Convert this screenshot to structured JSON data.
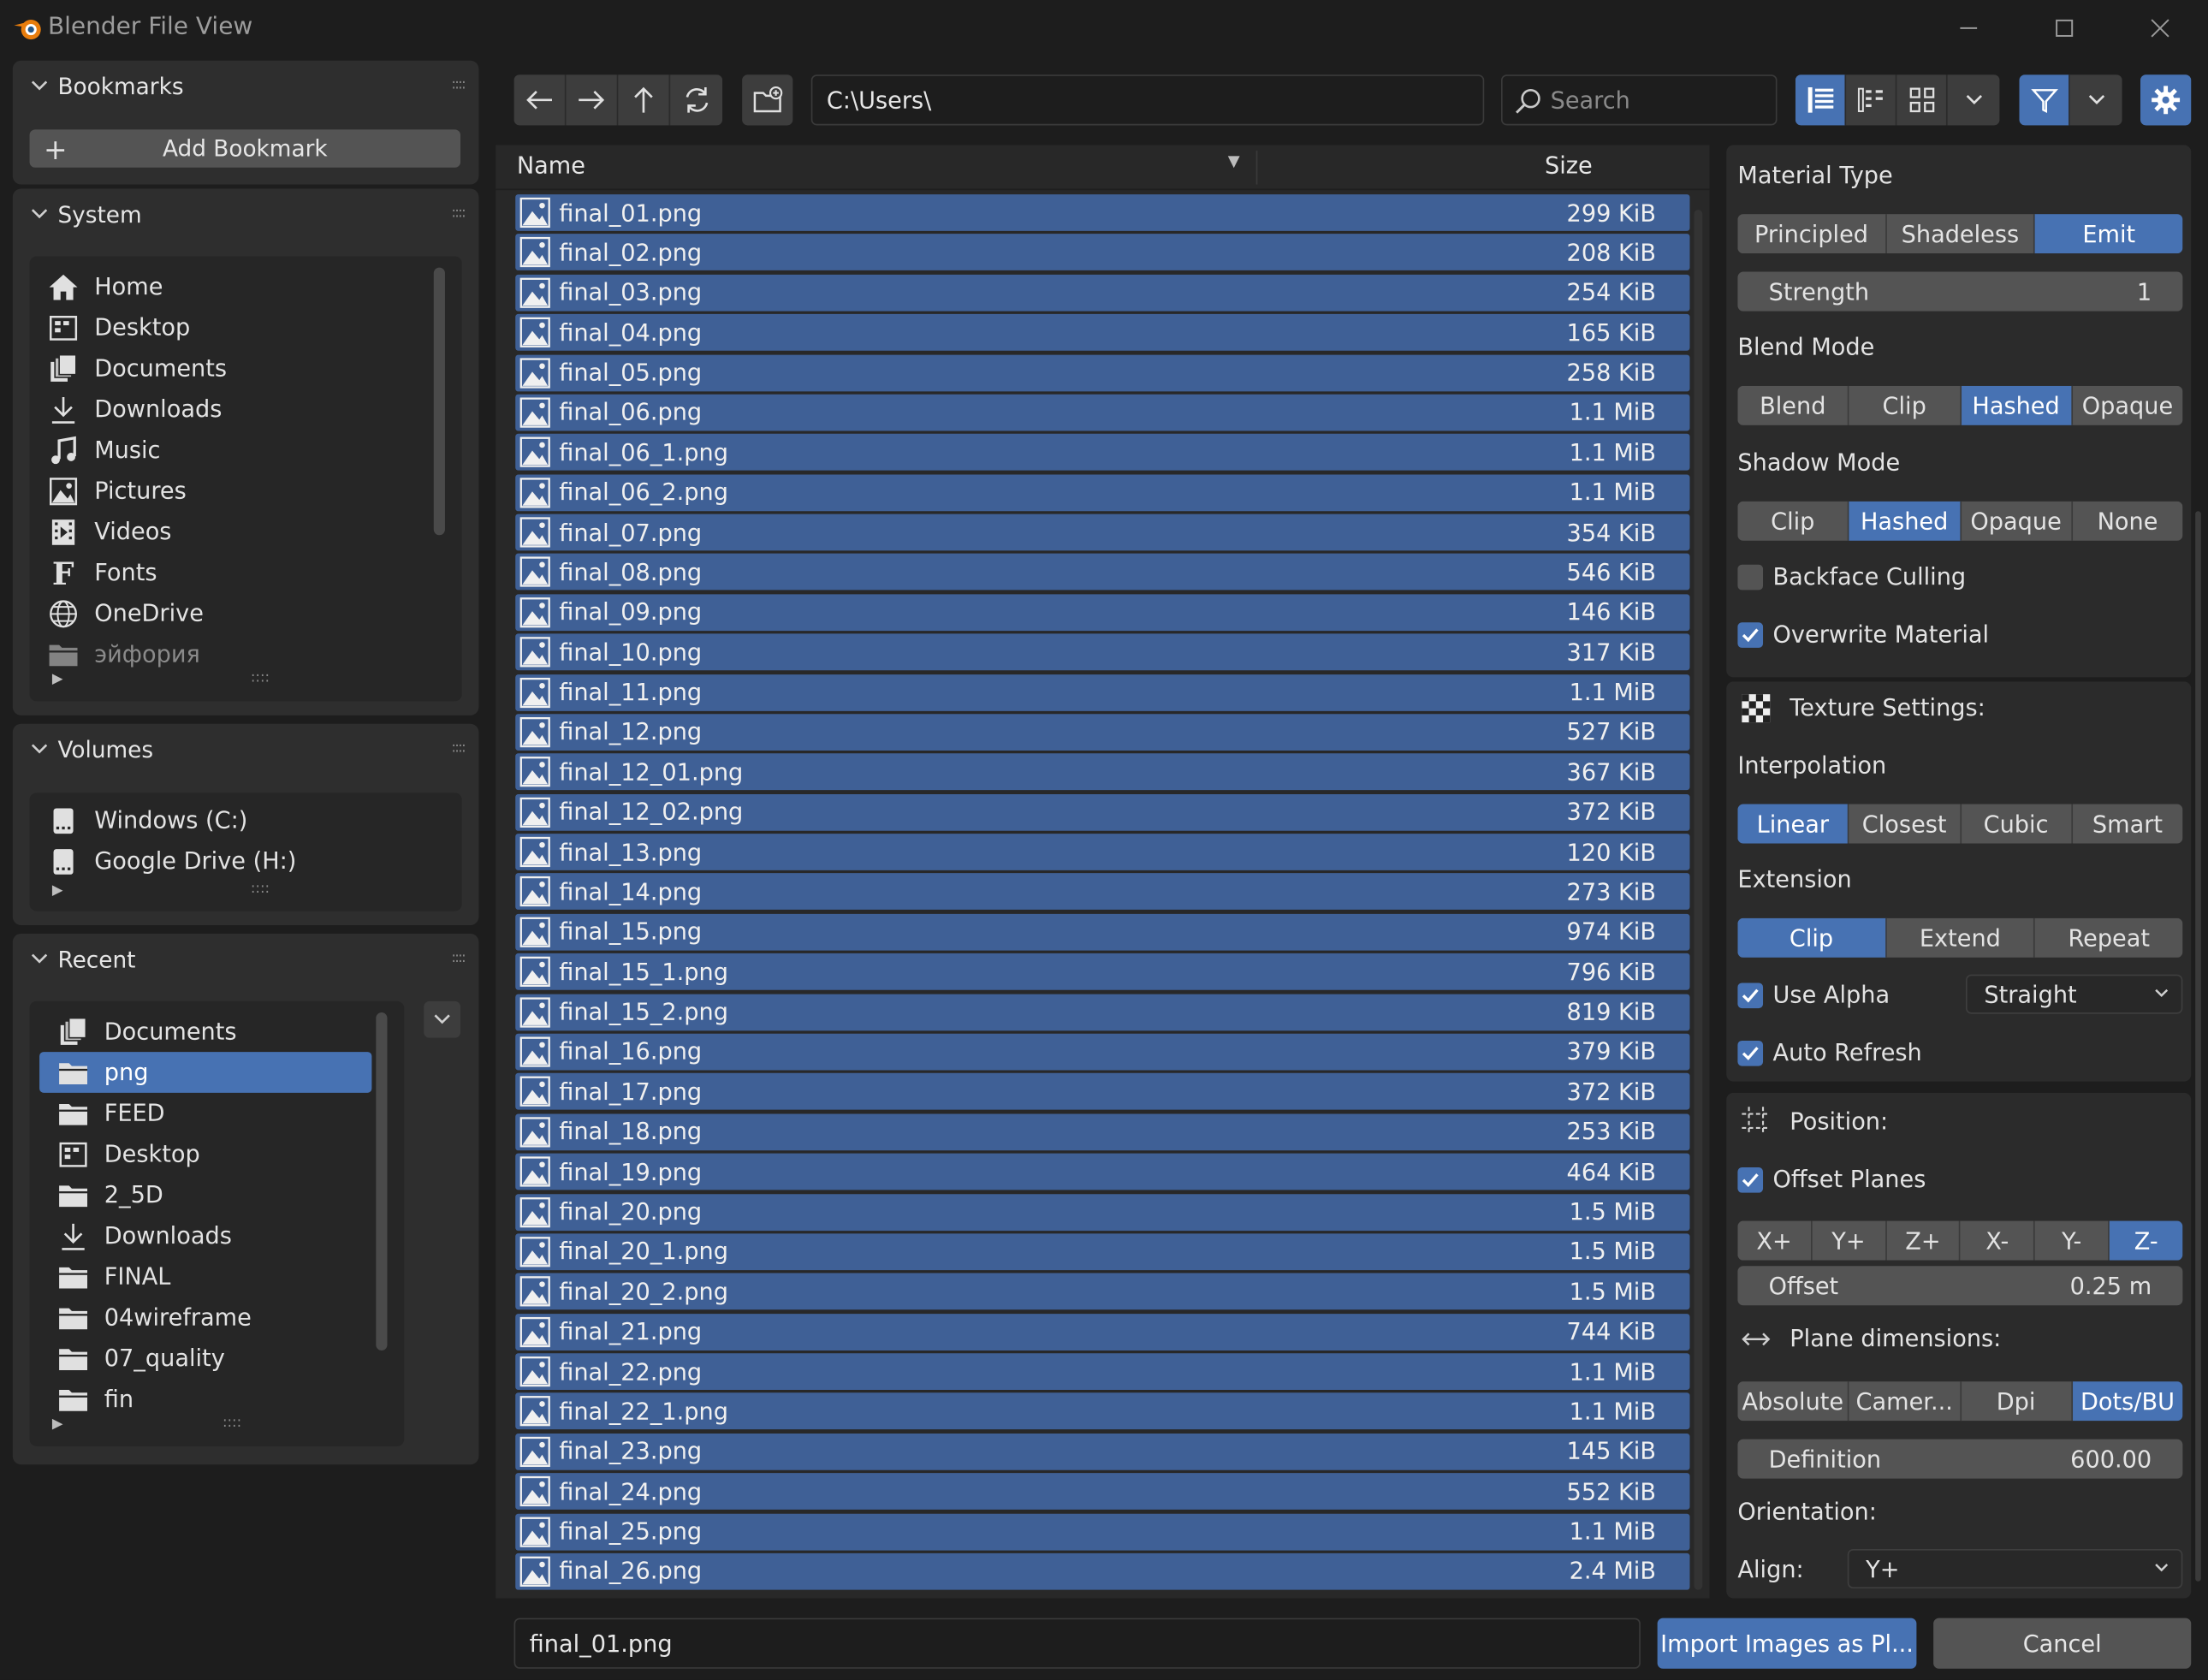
{
  "window": {
    "title": "Blender File View",
    "controls": [
      "minimize-icon",
      "maximize-icon",
      "close-icon"
    ]
  },
  "sidebar": {
    "bookmarks": {
      "title": "Bookmarks",
      "add_label": "Add Bookmark"
    },
    "system": {
      "title": "System",
      "items": [
        {
          "label": "Home",
          "icon": "home-icon"
        },
        {
          "label": "Desktop",
          "icon": "desktop-icon"
        },
        {
          "label": "Documents",
          "icon": "documents-icon"
        },
        {
          "label": "Downloads",
          "icon": "downloads-icon"
        },
        {
          "label": "Music",
          "icon": "music-icon"
        },
        {
          "label": "Pictures",
          "icon": "pictures-icon"
        },
        {
          "label": "Videos",
          "icon": "videos-icon"
        },
        {
          "label": "Fonts",
          "icon": "fonts-icon"
        },
        {
          "label": "OneDrive",
          "icon": "globe-icon"
        },
        {
          "label": "эйфория",
          "icon": "folder-icon"
        }
      ]
    },
    "volumes": {
      "title": "Volumes",
      "items": [
        {
          "label": "Windows (C:)",
          "icon": "drive-icon"
        },
        {
          "label": "Google Drive (H:)",
          "icon": "drive-icon"
        }
      ]
    },
    "recent": {
      "title": "Recent",
      "items": [
        {
          "label": "Documents",
          "icon": "documents-icon",
          "selected": false
        },
        {
          "label": "png",
          "icon": "folder-icon",
          "selected": true
        },
        {
          "label": "FEED",
          "icon": "folder-icon",
          "selected": false
        },
        {
          "label": "Desktop",
          "icon": "desktop-icon",
          "selected": false
        },
        {
          "label": "2_5D",
          "icon": "folder-icon",
          "selected": false
        },
        {
          "label": "Downloads",
          "icon": "downloads-icon",
          "selected": false
        },
        {
          "label": "FINAL",
          "icon": "folder-icon",
          "selected": false
        },
        {
          "label": "04wireframe",
          "icon": "folder-icon",
          "selected": false
        },
        {
          "label": "07_quality",
          "icon": "folder-icon",
          "selected": false
        },
        {
          "label": "fin",
          "icon": "folder-icon",
          "selected": false
        }
      ]
    }
  },
  "toolbar": {
    "path": "C:\\Users\\",
    "search_placeholder": "Search"
  },
  "filelist": {
    "col_name": "Name",
    "col_size": "Size",
    "files": [
      {
        "name": "final_01.png",
        "size": "299 KiB"
      },
      {
        "name": "final_02.png",
        "size": "208 KiB"
      },
      {
        "name": "final_03.png",
        "size": "254 KiB"
      },
      {
        "name": "final_04.png",
        "size": "165 KiB"
      },
      {
        "name": "final_05.png",
        "size": "258 KiB"
      },
      {
        "name": "final_06.png",
        "size": "1.1 MiB"
      },
      {
        "name": "final_06_1.png",
        "size": "1.1 MiB"
      },
      {
        "name": "final_06_2.png",
        "size": "1.1 MiB"
      },
      {
        "name": "final_07.png",
        "size": "354 KiB"
      },
      {
        "name": "final_08.png",
        "size": "546 KiB"
      },
      {
        "name": "final_09.png",
        "size": "146 KiB"
      },
      {
        "name": "final_10.png",
        "size": "317 KiB"
      },
      {
        "name": "final_11.png",
        "size": "1.1 MiB"
      },
      {
        "name": "final_12.png",
        "size": "527 KiB"
      },
      {
        "name": "final_12_01.png",
        "size": "367 KiB"
      },
      {
        "name": "final_12_02.png",
        "size": "372 KiB"
      },
      {
        "name": "final_13.png",
        "size": "120 KiB"
      },
      {
        "name": "final_14.png",
        "size": "273 KiB"
      },
      {
        "name": "final_15.png",
        "size": "974 KiB"
      },
      {
        "name": "final_15_1.png",
        "size": "796 KiB"
      },
      {
        "name": "final_15_2.png",
        "size": "819 KiB"
      },
      {
        "name": "final_16.png",
        "size": "379 KiB"
      },
      {
        "name": "final_17.png",
        "size": "372 KiB"
      },
      {
        "name": "final_18.png",
        "size": "253 KiB"
      },
      {
        "name": "final_19.png",
        "size": "464 KiB"
      },
      {
        "name": "final_20.png",
        "size": "1.5 MiB"
      },
      {
        "name": "final_20_1.png",
        "size": "1.5 MiB"
      },
      {
        "name": "final_20_2.png",
        "size": "1.5 MiB"
      },
      {
        "name": "final_21.png",
        "size": "744 KiB"
      },
      {
        "name": "final_22.png",
        "size": "1.1 MiB"
      },
      {
        "name": "final_22_1.png",
        "size": "1.1 MiB"
      },
      {
        "name": "final_23.png",
        "size": "145 KiB"
      },
      {
        "name": "final_24.png",
        "size": "552 KiB"
      },
      {
        "name": "final_25.png",
        "size": "1.1 MiB"
      },
      {
        "name": "final_26.png",
        "size": "2.4 MiB"
      }
    ]
  },
  "props": {
    "material_type": {
      "label": "Material Type",
      "options": [
        "Principled",
        "Shadeless",
        "Emit"
      ],
      "active": "Emit"
    },
    "strength": {
      "label": "Strength",
      "value": "1"
    },
    "blend_mode": {
      "label": "Blend Mode",
      "options": [
        "Blend",
        "Clip",
        "Hashed",
        "Opaque"
      ],
      "active": "Hashed"
    },
    "shadow_mode": {
      "label": "Shadow Mode",
      "options": [
        "Clip",
        "Hashed",
        "Opaque",
        "None"
      ],
      "active": "Hashed"
    },
    "backface_culling": {
      "label": "Backface Culling",
      "checked": false
    },
    "overwrite_material": {
      "label": "Overwrite Material",
      "checked": true
    },
    "texture_settings": {
      "label": "Texture Settings:"
    },
    "interpolation": {
      "label": "Interpolation",
      "options": [
        "Linear",
        "Closest",
        "Cubic",
        "Smart"
      ],
      "active": "Linear"
    },
    "extension": {
      "label": "Extension",
      "options": [
        "Clip",
        "Extend",
        "Repeat"
      ],
      "active": "Clip"
    },
    "use_alpha": {
      "label": "Use Alpha",
      "checked": true,
      "mode": "Straight"
    },
    "auto_refresh": {
      "label": "Auto Refresh",
      "checked": true
    },
    "position": {
      "label": "Position:"
    },
    "offset_planes": {
      "label": "Offset Planes",
      "checked": true
    },
    "axes": {
      "options": [
        "X+",
        "Y+",
        "Z+",
        "X-",
        "Y-",
        "Z-"
      ],
      "active": "Z-"
    },
    "offset": {
      "label": "Offset",
      "value": "0.25 m"
    },
    "plane_dimensions": {
      "label": "Plane dimensions:"
    },
    "size_mode": {
      "options": [
        "Absolute",
        "Camer...",
        "Dpi",
        "Dots/BU"
      ],
      "active": "Dots/BU"
    },
    "definition": {
      "label": "Definition",
      "value": "600.00"
    },
    "orientation": {
      "label": "Orientation:"
    },
    "align": {
      "label": "Align:",
      "value": "Y+"
    }
  },
  "footer": {
    "filename": "final_01.png",
    "import_label": "Import Images as Pl...",
    "cancel_label": "Cancel"
  },
  "colors": {
    "accent": "#4772b3",
    "selection_row": "#3f6096",
    "background": "#1d1d1d",
    "panel": "#2e2e2e"
  }
}
